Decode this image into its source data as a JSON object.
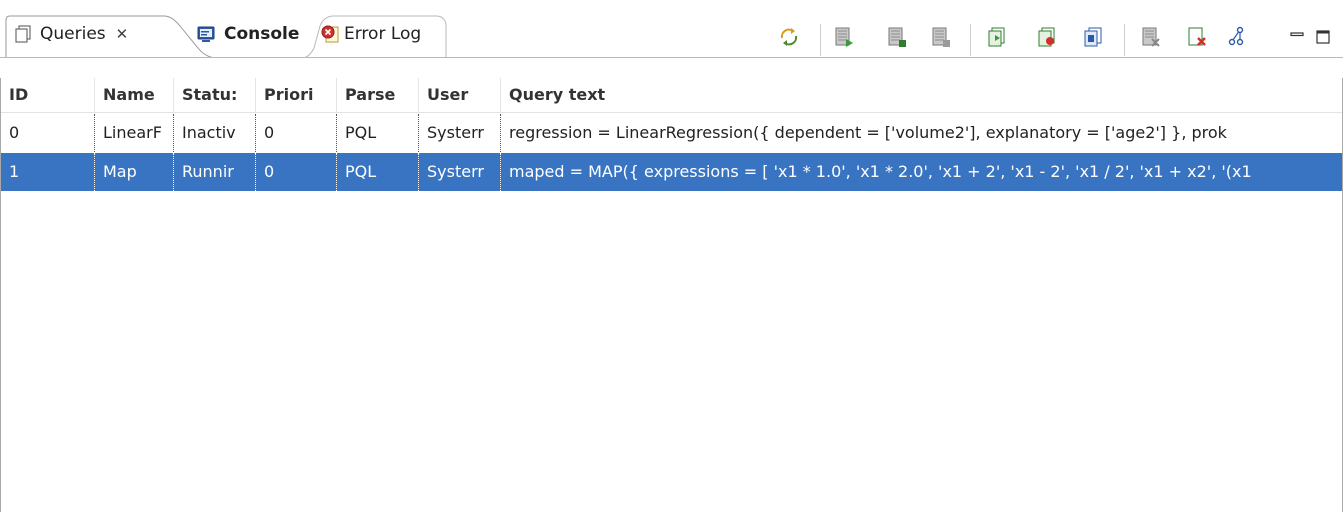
{
  "tabs": {
    "queries": {
      "label": "Queries",
      "close_glyph": "✕",
      "icon": "queries-view-icon"
    },
    "console": {
      "label": "Console",
      "icon": "console-icon"
    },
    "error_log": {
      "label": "Error Log",
      "icon": "error-log-icon"
    }
  },
  "toolbar": {
    "icons": [
      "refresh-icon",
      "start-query-icon",
      "stop-query-icon",
      "suspend-query-icon",
      "add-query-icon",
      "import-query-icon",
      "copy-query-icon",
      "remove-query-icon",
      "remove-all-icon",
      "show-plan-icon",
      "minimize-icon",
      "maximize-icon"
    ]
  },
  "table": {
    "columns": [
      "ID",
      "Name",
      "Statu:",
      "Priori",
      "Parse",
      "User",
      "Query text"
    ],
    "rows": [
      [
        "0",
        "LinearF",
        "Inactiv",
        "0",
        "PQL",
        "Systerr",
        "regression = LinearRegression({ dependent = ['volume2'], explanatory = ['age2'] }, prok"
      ],
      [
        "1",
        "Map",
        "Runnir",
        "0",
        "PQL",
        "Systerr",
        "maped = MAP({ expressions = [ 'x1 * 1.0', 'x1 * 2.0', 'x1 + 2', 'x1 - 2', 'x1 / 2', 'x1 + x2', '(x1"
      ]
    ],
    "selected_row": 1
  },
  "colors": {
    "selection": "#3874c2",
    "error": "#d0302a"
  }
}
